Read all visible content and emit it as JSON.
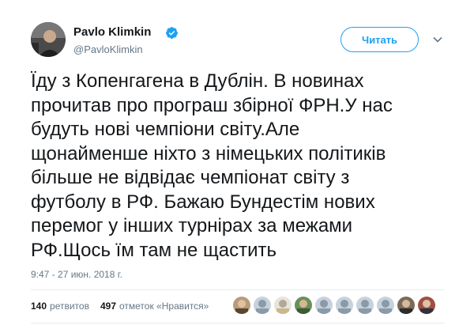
{
  "author": {
    "name": "Pavlo Klimkin",
    "handle": "@PavloKlimkin",
    "verified_color": "#1da1f2"
  },
  "follow_button_label": "Читать",
  "tweet": {
    "lines": [
      "Їду з Копенгагена в Дублін. В новинах",
      "прочитав про програш збірної ФРН.У нас",
      "будуть нові чемпіони світу.Але",
      "щонайменше ніхто з німецьких політиків",
      "більше не відвідає чемпіонат світу з",
      "футболу в РФ. Бажаю Бундестім нових",
      "перемог у інших турнірах за межами",
      "РФ.Щось їм там не щастить"
    ],
    "timestamp": "9:47 - 27 июн. 2018 г."
  },
  "stats": {
    "retweets_count": "140",
    "retweets_label": "ретвитов",
    "likes_count": "497",
    "likes_label": "отметок «Нравится»"
  },
  "liker_avatars": [
    "liker-1",
    "liker-2",
    "liker-3",
    "liker-4",
    "liker-5",
    "liker-6",
    "liker-7",
    "liker-8",
    "liker-9",
    "liker-10"
  ],
  "icons": {
    "verified": "verified-badge-icon",
    "caret": "chevron-down-icon"
  }
}
